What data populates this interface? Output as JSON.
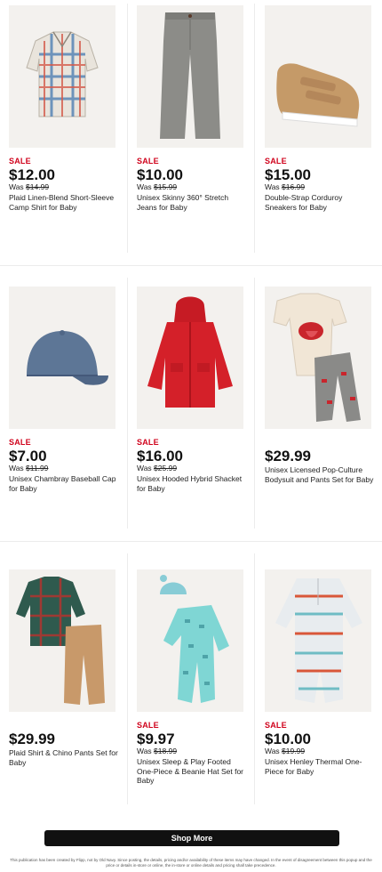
{
  "products": [
    {
      "sale": "SALE",
      "price": "$12.00",
      "was_label": "Was ",
      "was_price": "$14.99",
      "desc": "Plaid Linen-Blend Short-Sleeve Camp Shirt for Baby",
      "icon": "plaid-shirt"
    },
    {
      "sale": "SALE",
      "price": "$10.00",
      "was_label": "Was ",
      "was_price": "$15.99",
      "desc": "Unisex Skinny 360° Stretch Jeans for Baby",
      "icon": "gray-jeans"
    },
    {
      "sale": "SALE",
      "price": "$15.00",
      "was_label": "Was ",
      "was_price": "$16.99",
      "desc": "Double-Strap Corduroy Sneakers for Baby",
      "icon": "tan-sneakers"
    },
    {
      "sale": "SALE",
      "price": "$7.00",
      "was_label": "Was ",
      "was_price": "$11.99",
      "desc": "Unisex Chambray Baseball Cap for Baby",
      "icon": "blue-cap"
    },
    {
      "sale": "SALE",
      "price": "$16.00",
      "was_label": "Was ",
      "was_price": "$25.99",
      "desc": "Unisex Hooded Hybrid Shacket for Baby",
      "icon": "red-jacket"
    },
    {
      "sale": "",
      "price": "$29.99",
      "was_label": "",
      "was_price": "",
      "desc": "Unisex Licensed Pop-Culture Bodysuit and Pants Set for Baby",
      "icon": "bodysuit-set"
    },
    {
      "sale": "",
      "price": "$29.99",
      "was_label": "",
      "was_price": "",
      "desc": "Plaid Shirt & Chino Pants Set for Baby",
      "icon": "shirt-chino-set"
    },
    {
      "sale": "SALE",
      "price": "$9.97",
      "was_label": "Was ",
      "was_price": "$18.99",
      "desc": "Unisex Sleep & Play Footed One-Piece & Beanie Hat Set for Baby",
      "icon": "sleep-play-set"
    },
    {
      "sale": "SALE",
      "price": "$10.00",
      "was_label": "Was ",
      "was_price": "$19.99",
      "desc": "Unisex Henley Thermal One-Piece for Baby",
      "icon": "henley-one-piece"
    }
  ],
  "shop_more": "Shop More",
  "disclaimer": "This publication has been created by Flipp, not by Old Navy. Since posting, the details, pricing and/or availability of these items may have changed. In the event of disagreement between this popup and the price or details in-store or online, the in-store or online details and pricing shall take precedence."
}
